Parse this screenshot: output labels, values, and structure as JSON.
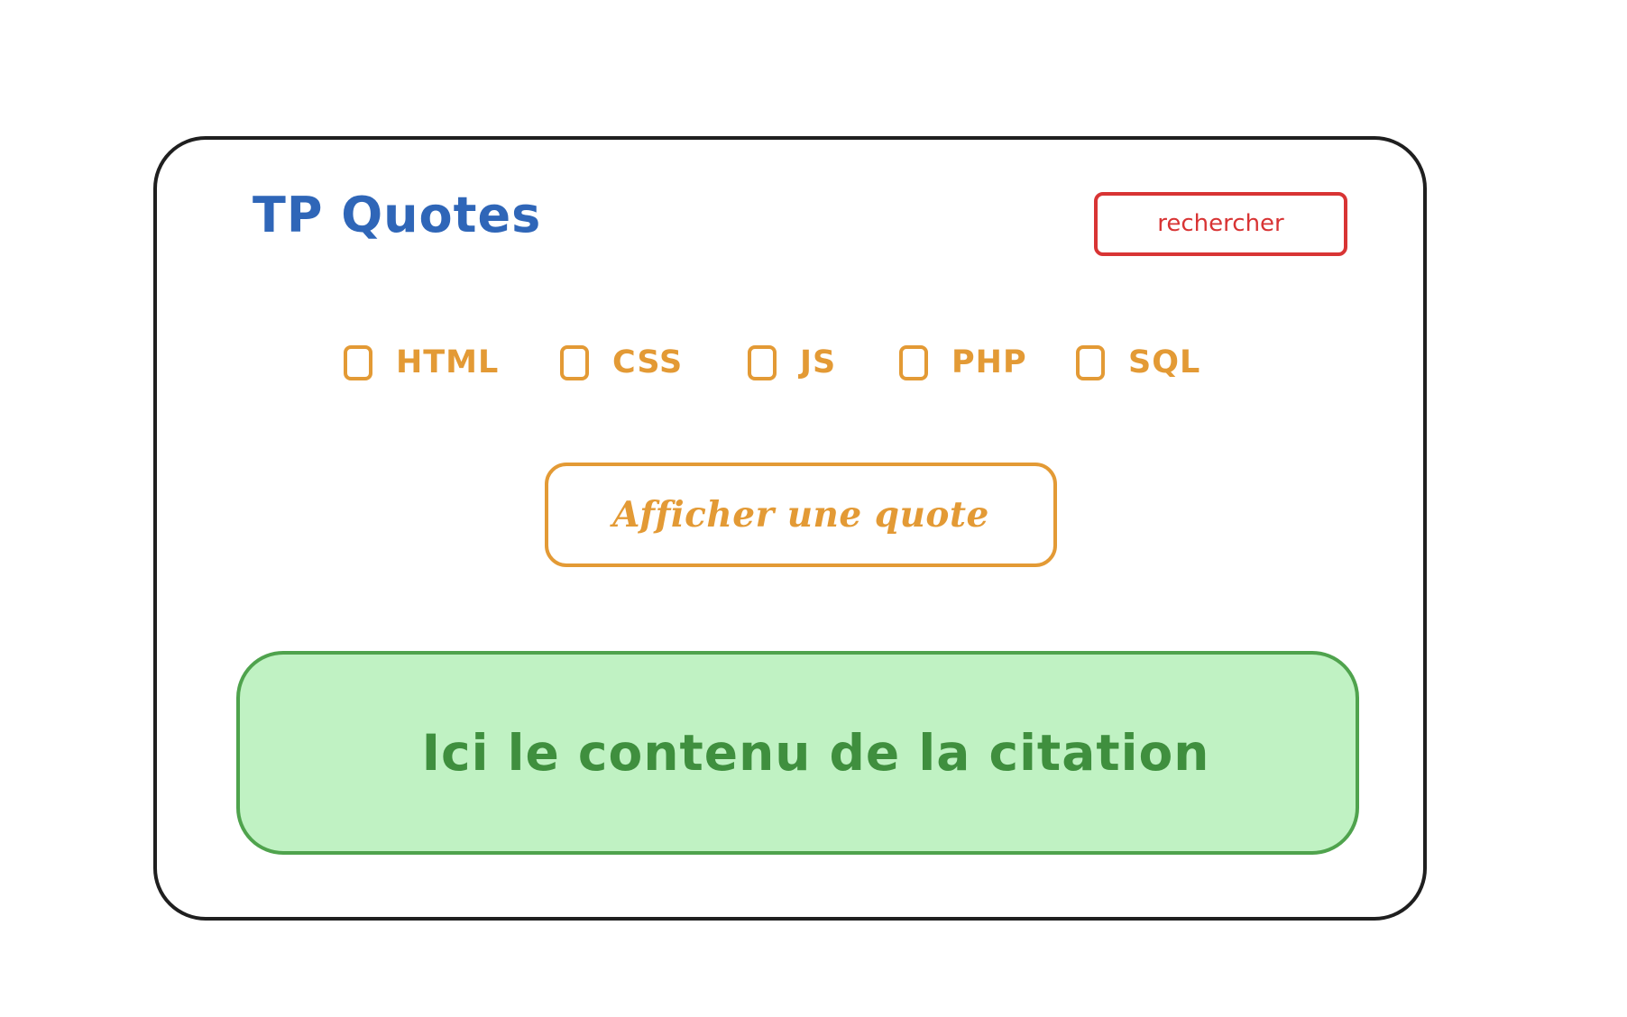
{
  "app": {
    "title": "TP Quotes"
  },
  "toolbar": {
    "search_label": "rechercher"
  },
  "filters": [
    {
      "label": "HTML"
    },
    {
      "label": "CSS"
    },
    {
      "label": "JS"
    },
    {
      "label": "PHP"
    },
    {
      "label": "SQL"
    }
  ],
  "actions": {
    "show_quote_label": "Afficher une quote"
  },
  "quote": {
    "content": "Ici le contenu de la citation"
  },
  "colors": {
    "frame": "#1f1f1f",
    "title": "#2f66b8",
    "search": "#d83434",
    "filters": "#e39a35",
    "quote_fill": "#c0f2c3",
    "quote_border": "#4fa34d",
    "quote_text": "#3f8f3e"
  }
}
